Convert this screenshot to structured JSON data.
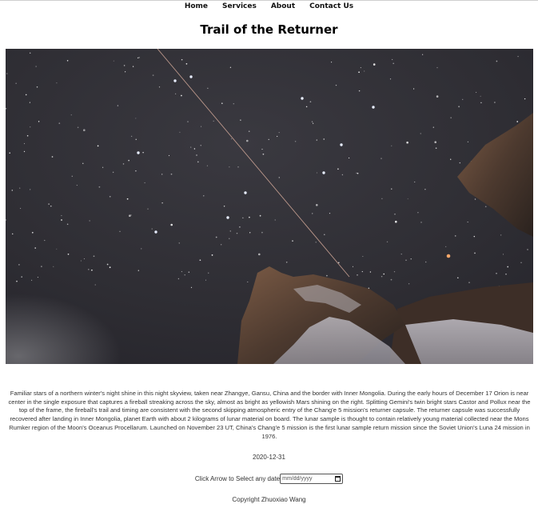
{
  "nav": {
    "items": [
      "Home",
      "Services",
      "About",
      "Contact Us"
    ]
  },
  "page": {
    "title": "Trail of the Returner"
  },
  "photo": {
    "alt_description": ""
  },
  "caption": {
    "text": "Familiar stars of a northern winter's night shine in this night skyview, taken near Zhangye, Gansu, China and the border with Inner Mongolia. During the early hours of December 17 Orion is near center in the single exposure that captures a fireball streaking across the sky, almost as bright as yellowish Mars shining on the right. Splitting Gemini's twin bright stars Castor and Pollux near the top of the frame, the fireball's trail and timing are consistent with the second skipping atmospheric entry of the Chang'e 5 mission's returner capsule. The returner capsule was successfully recovered after landing in Inner Mongolia, planet Earth with about 2 kilograms of lunar material on board. The lunar sample is thought to contain relatively young material collected near the Mons Rumker region of the Moon's Oceanus Procellarum. Launched on November 23 UT, China's Chang'e 5 mission is the first lunar sample return mission since the Soviet Union's Luna 24 mission in 1976."
  },
  "date": {
    "value": "2020-12-31"
  },
  "picker": {
    "label": "Click Arrow to Select any date",
    "placeholder": "mm/dd/yyyy",
    "icon": "calendar-icon"
  },
  "footer": {
    "copyright": "Copyright Zhuoxiao Wang"
  }
}
